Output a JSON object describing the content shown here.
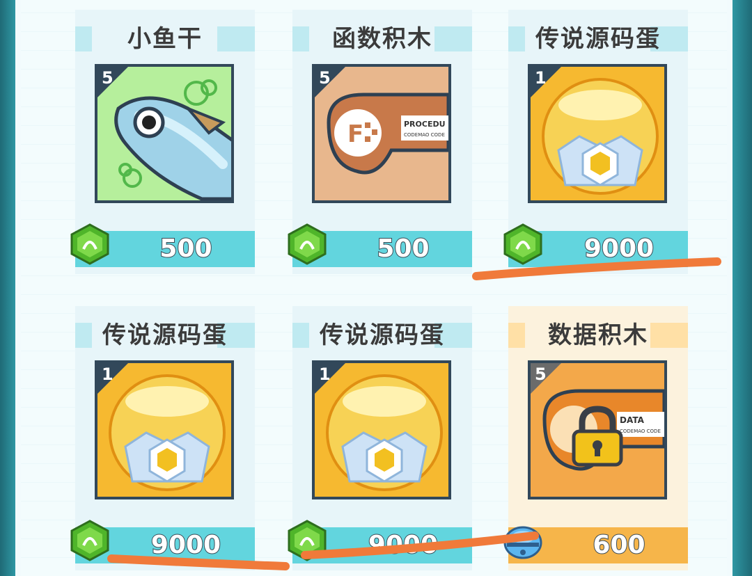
{
  "cards": [
    {
      "title": "小鱼干",
      "count": "5",
      "price": "500",
      "currency_icon": "green-gem-icon",
      "locked": false
    },
    {
      "title": "函数积木",
      "count": "5",
      "price": "500",
      "currency_icon": "green-gem-icon",
      "locked": false
    },
    {
      "title": "传说源码蛋",
      "count": "1",
      "price": "9000",
      "currency_icon": "green-gem-icon",
      "locked": false
    },
    {
      "title": "传说源码蛋",
      "count": "1",
      "price": "9000",
      "currency_icon": "green-gem-icon",
      "locked": false
    },
    {
      "title": "传说源码蛋",
      "count": "1",
      "price": "9000",
      "currency_icon": "green-gem-icon",
      "locked": false
    },
    {
      "title": "数据积木",
      "count": "5",
      "price": "600",
      "currency_icon": "blue-bell-icon",
      "locked": true
    }
  ],
  "item_art": {
    "block_label_fx": "PROCEDU",
    "block_sub_fx": "CODEMAO CODE",
    "block_label_data": "DATA",
    "block_sub_data": "CODEMAO CODE"
  },
  "colors": {
    "annotation": "#f07a3a",
    "price_bar": "#62d5de",
    "price_bar_locked": "#f6b54a"
  }
}
